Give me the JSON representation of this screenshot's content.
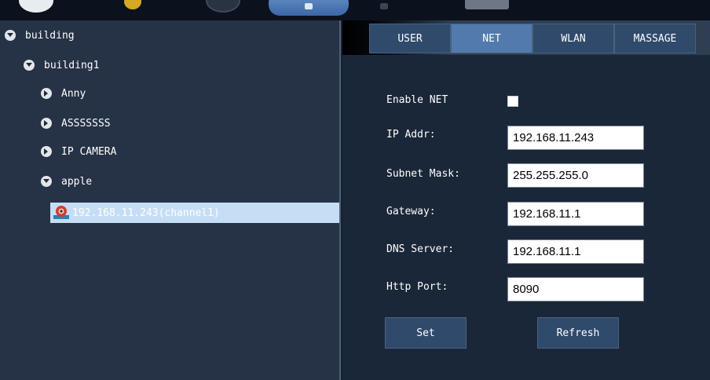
{
  "toolbar": {
    "icons": [
      "logo-icon",
      "folder-icon",
      "record-icon",
      "network-icon",
      "settings-icon",
      "view-icon"
    ]
  },
  "tree": {
    "root": {
      "label": "building",
      "expanded": true
    },
    "group": {
      "label": "building1",
      "expanded": true
    },
    "items": [
      {
        "label": "Anny",
        "expanded": false
      },
      {
        "label": "ASSSSSSS",
        "expanded": false
      },
      {
        "label": "IP CAMERA",
        "expanded": false
      },
      {
        "label": "apple",
        "expanded": true
      }
    ],
    "selected_device": {
      "label": "192.168.11.243(channel1)",
      "icon": "camera-icon"
    }
  },
  "tabs": [
    {
      "label": "USER",
      "active": false
    },
    {
      "label": "NET",
      "active": true
    },
    {
      "label": "WLAN",
      "active": false
    },
    {
      "label": "MASSAGE",
      "active": false
    }
  ],
  "form": {
    "enable_net": {
      "label": "Enable NET",
      "checked": false
    },
    "ip_addr": {
      "label": "IP Addr:",
      "value": "192.168.11.243"
    },
    "subnet_mask": {
      "label": "Subnet Mask:",
      "value": "255.255.255.0"
    },
    "gateway": {
      "label": "Gateway:",
      "value": "192.168.11.1"
    },
    "dns_server": {
      "label": "DNS Server:",
      "value": "192.168.11.1"
    },
    "http_port": {
      "label": "Http Port:",
      "value": "8090"
    }
  },
  "buttons": {
    "set": "Set",
    "refresh": "Refresh"
  },
  "colors": {
    "tree_bg": "#263245",
    "panel_bg": "#1a2738",
    "tab_bg": "#2f4a6b",
    "tab_active": "#527aad",
    "selection": "#c6def5"
  }
}
